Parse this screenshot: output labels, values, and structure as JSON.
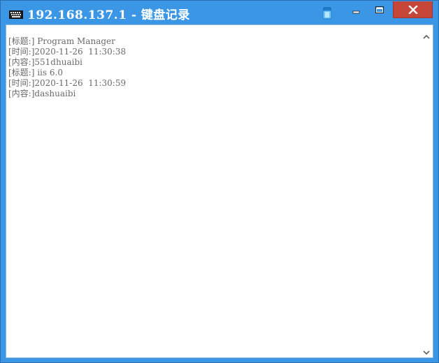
{
  "window": {
    "title": "192.168.137.1 - 键盘记录",
    "app_icon": "keyboard-icon",
    "pin_icon": "pin-icon",
    "colors": {
      "titlebar": "#3b97e6",
      "close_button": "#c7463a",
      "text": "#6a6a6a"
    }
  },
  "buttons": {
    "minimize_icon": "minimize-icon",
    "maximize_icon": "maximize-icon",
    "close_icon": "close-icon"
  },
  "log": {
    "lines": [
      "[标题:] Program Manager",
      "[时间:]2020-11-26  11:30:38",
      "[内容:]551dhuaibi",
      "[标题:] iis 6.0",
      "[时间:]2020-11-26  11:30:59",
      "[内容:]dashuaibi"
    ]
  },
  "scrollbar": {
    "up_icon": "chevron-up-icon",
    "down_icon": "chevron-down-icon"
  }
}
